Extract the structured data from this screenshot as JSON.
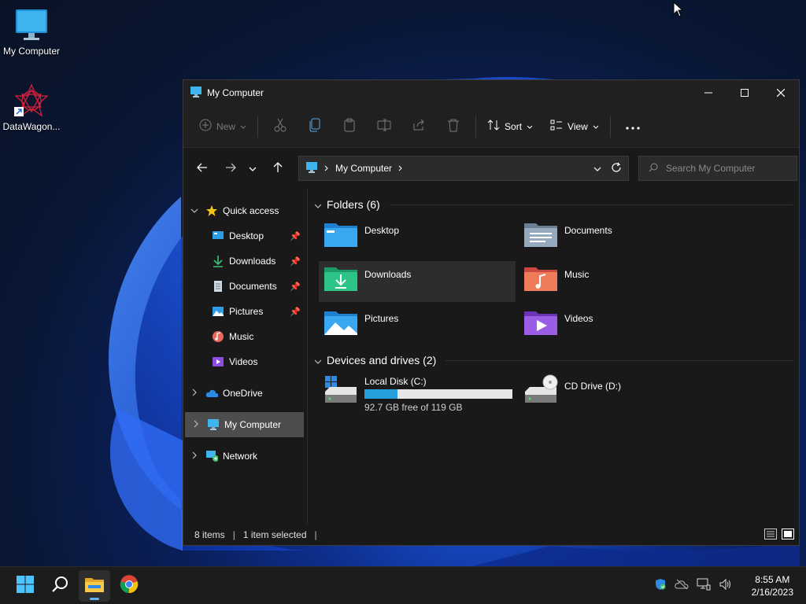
{
  "desktop": {
    "icons": [
      {
        "label": "My Computer"
      },
      {
        "label": "DataWagon..."
      }
    ]
  },
  "window": {
    "title": "My Computer",
    "toolbar": {
      "new_label": "New",
      "sort_label": "Sort",
      "view_label": "View"
    },
    "address": {
      "path": "My Computer"
    },
    "search": {
      "placeholder": "Search My Computer"
    },
    "sidebar": {
      "quick_access": "Quick access",
      "items": [
        {
          "label": "Desktop",
          "pinned": true
        },
        {
          "label": "Downloads",
          "pinned": true
        },
        {
          "label": "Documents",
          "pinned": true
        },
        {
          "label": "Pictures",
          "pinned": true
        },
        {
          "label": "Music",
          "pinned": false
        },
        {
          "label": "Videos",
          "pinned": false
        }
      ],
      "onedrive": "OneDrive",
      "my_computer": "My Computer",
      "network": "Network"
    },
    "content": {
      "folders_header": "Folders (6)",
      "folders": [
        {
          "label": "Desktop"
        },
        {
          "label": "Documents"
        },
        {
          "label": "Downloads"
        },
        {
          "label": "Music"
        },
        {
          "label": "Pictures"
        },
        {
          "label": "Videos"
        }
      ],
      "drives_header": "Devices and drives (2)",
      "drives": [
        {
          "label": "Local Disk (C:)",
          "free_text": "92.7 GB free of 119 GB",
          "used_fraction": 0.221
        },
        {
          "label": "CD Drive (D:)"
        }
      ]
    },
    "status": {
      "items": "8 items",
      "selected": "1 item selected"
    }
  },
  "taskbar": {
    "time": "8:55 AM",
    "date": "2/16/2023"
  },
  "colors": {
    "accent": "#26a0da",
    "selected_bg": "#4d4d4d"
  }
}
